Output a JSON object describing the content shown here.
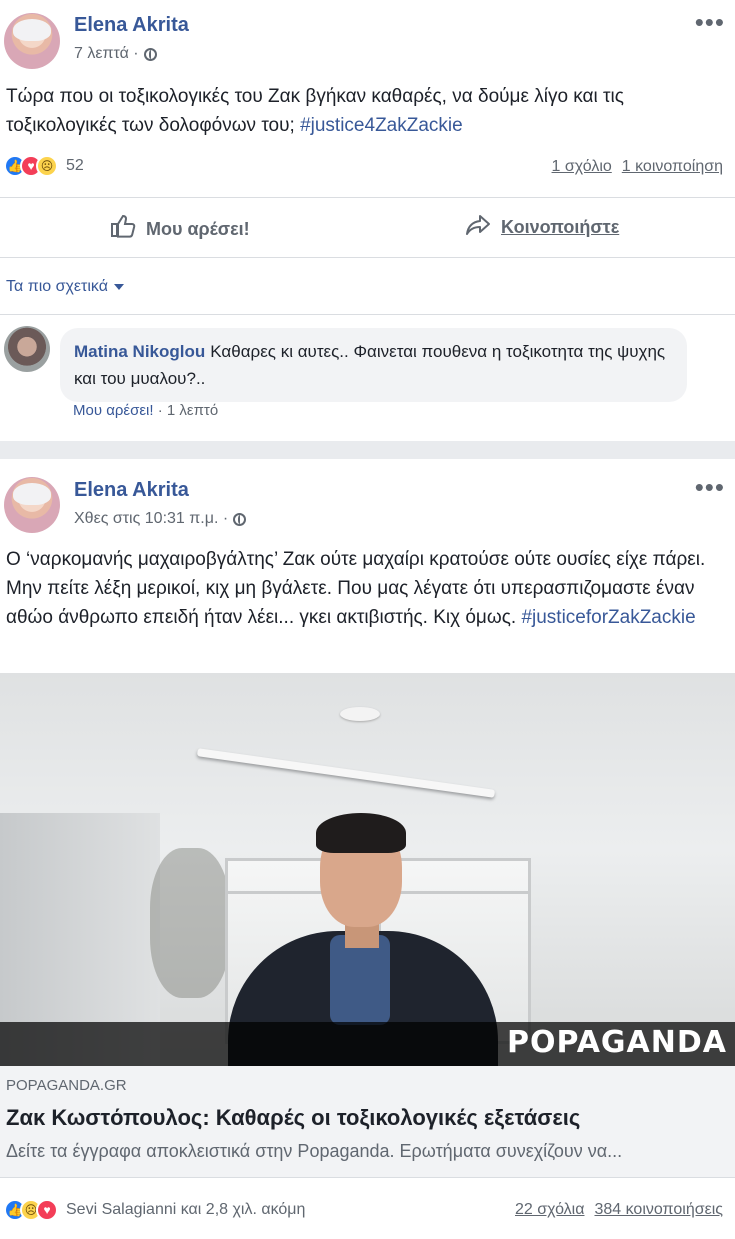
{
  "post1": {
    "author": "Elena Akrita",
    "time": "7 λεπτά ·",
    "text_before": "Τώρα που οι τοξικολογικές του Ζακ βγήκαν καθαρές, να δούμε λίγο και τις τοξικολογικές των δολοφόνων του; ",
    "hashtag": "#justice4ZakZackie",
    "reaction_count": "52",
    "comments_link": "1 σχόλιο",
    "shares_link": "1 κοινοποίηση",
    "like_label": "Μου αρέσει!",
    "share_label": "Κοινοποιήστε",
    "most_relevant": "Τα πιο σχετικά",
    "comment": {
      "author": "Matina Nikoglou",
      "text": "Καθαρες κι αυτες.. Φαινεται πουθενα η τοξικοτητα της ψυχης και του μυαλου?..",
      "like_label": "Μου αρέσει!",
      "time": " · 1 λεπτό"
    }
  },
  "post2": {
    "author": "Elena Akrita",
    "time": "Χθες στις 10:31 π.μ. ·",
    "text_before": "Ο ‘ναρκομανής μαχαιροβγάλτης’ Ζακ ούτε μαχαίρι κρατούσε ούτε ουσίες είχε πάρει. Μην πείτε λέξη μερικοί, κιχ μη βγάλετε. Που μας λέγατε ότι υπερασπιζομαστε έναν αθώο άνθρωπο επειδή ήταν λέει... γκει ακτιβιστής. Κιχ όμως. ",
    "hashtag": "#justiceforZakZackie",
    "image_brand": "POPAGANDA",
    "link": {
      "domain": "POPAGANDA.GR",
      "title": "Ζακ Κωστόπουλος: Καθαρές οι τοξικολογικές εξετάσεις",
      "description": "Δείτε τα έγγραφα αποκλειστικά στην Popaganda. Ερωτήματα συνεχίζουν να..."
    },
    "reactors": "Sevi Salagianni και 2,8 χιλ. ακόμη",
    "comments_link": "22 σχόλια",
    "shares_link": "384 κοινοποιήσεις"
  },
  "icons": {
    "more": "•••",
    "like": "👍",
    "love": "♥",
    "sad": "☹",
    "share": "➦"
  },
  "colors": {
    "link_blue": "#385898",
    "like_blue": "#2078f4",
    "love_red": "#f33e58",
    "sad_yellow": "#fcd34d",
    "feed_bg": "#e9ebee"
  }
}
